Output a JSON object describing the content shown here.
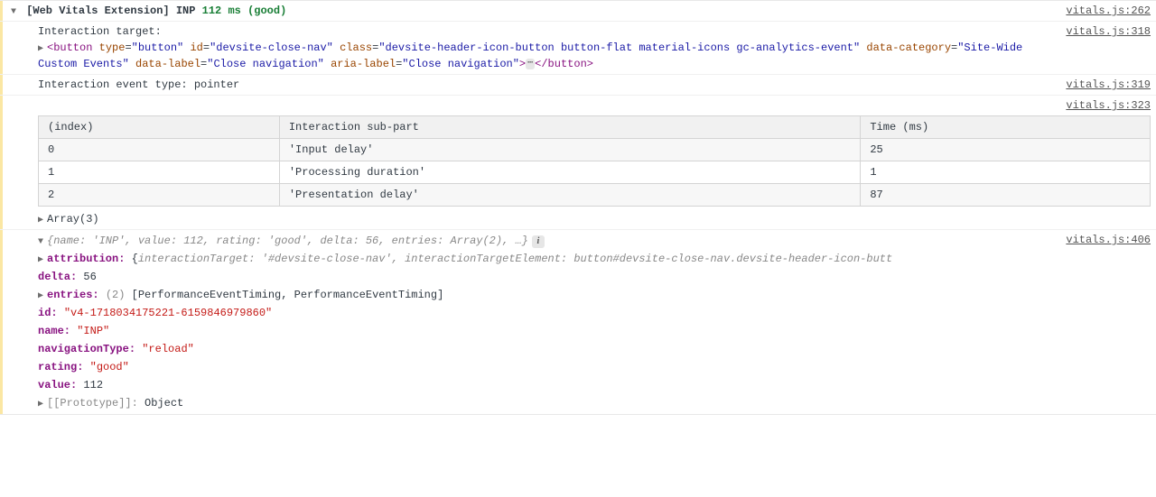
{
  "header": {
    "arrow": "▼",
    "prefix": "[Web Vitals Extension] INP ",
    "value_ms": "112 ms",
    "rating": "(good)",
    "src": "vitals.js:262"
  },
  "interaction_target": {
    "label": "Interaction target:",
    "src": "vitals.js:318",
    "arrow": "▶",
    "tag_open": "<button",
    "attrs": [
      {
        "n": "type",
        "v": "\"button\""
      },
      {
        "n": "id",
        "v": "\"devsite-close-nav\""
      },
      {
        "n": "class",
        "v": "\"devsite-header-icon-button button-flat material-icons gc-analytics-event\""
      },
      {
        "n": "data-category",
        "v": "\"Site-Wide Custom Events\""
      },
      {
        "n": "data-label",
        "v": "\"Close navigation\""
      },
      {
        "n": "aria-label",
        "v": "\"Close navigation\""
      }
    ],
    "gt": ">",
    "ellipsis": "⋯",
    "tag_close": "</button>"
  },
  "event_type": {
    "text": "Interaction event type: pointer",
    "src": "vitals.js:319"
  },
  "table_block": {
    "src": "vitals.js:323",
    "headers": [
      "(index)",
      "Interaction sub-part",
      "Time (ms)"
    ],
    "rows": [
      [
        "0",
        "'Input delay'",
        "25"
      ],
      [
        "1",
        "'Processing duration'",
        "1"
      ],
      [
        "2",
        "'Presentation delay'",
        "87"
      ]
    ],
    "footer_arrow": "▶",
    "footer": "Array(3)"
  },
  "object_block": {
    "src": "vitals.js:406",
    "arrow": "▼",
    "summary_parts": {
      "open": "{",
      "kv": [
        {
          "k": "name:",
          "v": "'INP'"
        },
        {
          "k": "value:",
          "v": "112"
        },
        {
          "k": "rating:",
          "v": "'good'"
        },
        {
          "k": "delta:",
          "v": "56"
        },
        {
          "k": "entries:",
          "v": "Array(2)"
        }
      ],
      "more": ", …}"
    },
    "info_badge": "i",
    "props": {
      "attribution_arrow": "▶",
      "attribution_key": "attribution:",
      "attribution_open": " {",
      "attribution_k1": "interactionTarget:",
      "attribution_v1": "'#devsite-close-nav'",
      "attribution_sep": ", ",
      "attribution_k2": "interactionTargetElement:",
      "attribution_v2": "button#devsite-close-nav.devsite-header-icon-butt",
      "delta_k": "delta:",
      "delta_v": "56",
      "entries_arrow": "▶",
      "entries_k": "entries:",
      "entries_count": "(2)",
      "entries_v": " [PerformanceEventTiming, PerformanceEventTiming]",
      "id_k": "id:",
      "id_v": "\"v4-1718034175221-6159846979860\"",
      "name_k": "name:",
      "name_v": "\"INP\"",
      "navType_k": "navigationType:",
      "navType_v": "\"reload\"",
      "rating_k": "rating:",
      "rating_v": "\"good\"",
      "value_k": "value:",
      "value_v": "112",
      "proto_arrow": "▶",
      "proto_k": "[[Prototype]]:",
      "proto_v": "Object"
    }
  }
}
